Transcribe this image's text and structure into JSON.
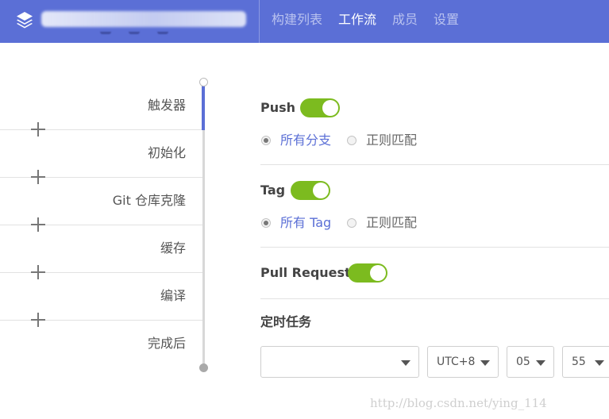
{
  "header": {
    "logo_icon": "layers-icon",
    "project_name": "",
    "nav": [
      {
        "label": "构建列表",
        "active": false
      },
      {
        "label": "工作流",
        "active": true
      },
      {
        "label": "成员",
        "active": false
      },
      {
        "label": "设置",
        "active": false
      }
    ],
    "colors": {
      "background": "#5b6fd6",
      "nav_active": "#ffffff",
      "nav_inactive": "#b9c2ef"
    }
  },
  "pipeline": {
    "stages": [
      {
        "label": "触发器",
        "active": true
      },
      {
        "label": "初始化",
        "active": false
      },
      {
        "label": "Git 仓库克隆",
        "active": false
      },
      {
        "label": "缓存",
        "active": false
      },
      {
        "label": "编译",
        "active": false
      },
      {
        "label": "完成后",
        "active": false
      }
    ],
    "add_icon": "plus-icon",
    "accent": "#5b6fd6"
  },
  "trigger": {
    "push": {
      "label": "Push",
      "enabled": true,
      "options": [
        {
          "label": "所有分支",
          "checked": true
        },
        {
          "label": "正则匹配",
          "checked": false
        }
      ]
    },
    "tag": {
      "label": "Tag",
      "enabled": true,
      "options": [
        {
          "label": "所有 Tag",
          "checked": true
        },
        {
          "label": "正则匹配",
          "checked": false
        }
      ]
    },
    "pull_request": {
      "label": "Pull Request",
      "enabled": true
    },
    "schedule": {
      "label": "定时任务",
      "frequency": "",
      "timezone": "UTC+8",
      "hour": "05",
      "minute": "55"
    },
    "toggle_color": "#7cbb1f"
  },
  "watermark": "http://blog.csdn.net/ying_114"
}
